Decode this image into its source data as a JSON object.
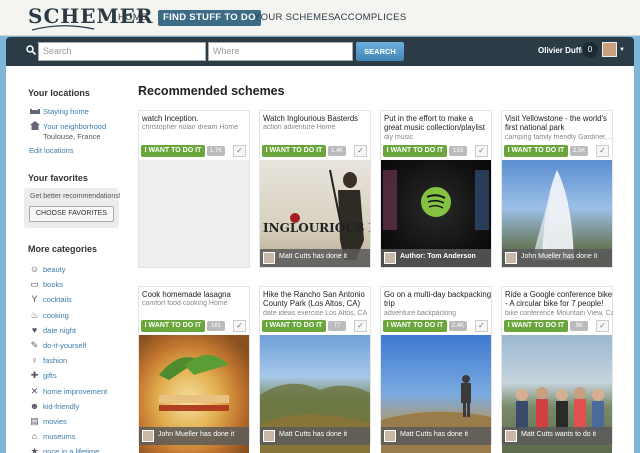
{
  "brand": {
    "logo": "SCHEMER"
  },
  "nav": [
    {
      "label": "HOME"
    },
    {
      "label": "FIND STUFF TO DO"
    },
    {
      "label": "YOUR SCHEMES"
    },
    {
      "label": "ACCOMPLICES"
    }
  ],
  "search": {
    "query_placeholder": "Search",
    "where_placeholder": "Where",
    "button": "SEARCH"
  },
  "user": {
    "name": "Olivier Duffez",
    "count": "0"
  },
  "sidebar": {
    "locations_title": "Your locations",
    "locations": [
      {
        "label": "Staying home",
        "icon": "sofa-icon"
      },
      {
        "label": "Your neighborhood",
        "sub": "Toulouse, France",
        "icon": "house-icon"
      }
    ],
    "edit_locations": "Edit locations",
    "favorites_title": "Your favorites",
    "favorites_hint": "Get better recommendations!",
    "choose_favorites": "CHOOSE FAVORITES",
    "categories_title": "More categories",
    "categories": [
      {
        "label": "beauty",
        "icon": "☺"
      },
      {
        "label": "books",
        "icon": "▭"
      },
      {
        "label": "cocktails",
        "icon": "Y"
      },
      {
        "label": "cooking",
        "icon": "♨"
      },
      {
        "label": "date night",
        "icon": "♥"
      },
      {
        "label": "do-it-yourself",
        "icon": "✎"
      },
      {
        "label": "fashion",
        "icon": "♀"
      },
      {
        "label": "gifts",
        "icon": "✚"
      },
      {
        "label": "home improvement",
        "icon": "✕"
      },
      {
        "label": "kid-friendly",
        "icon": "☻"
      },
      {
        "label": "movies",
        "icon": "▤"
      },
      {
        "label": "museums",
        "icon": "⌂"
      },
      {
        "label": "once in a lifetime",
        "icon": "★"
      }
    ]
  },
  "content": {
    "title": "Recommended schemes",
    "cta": "I WANT TO DO IT",
    "cards": [
      {
        "title": "watch Inception.",
        "tags": "christopher nolan dream Home",
        "count": "1.7K",
        "footer": ""
      },
      {
        "title": "Watch Inglourious Basterds",
        "tags": "action adventure Home",
        "count": "1.4K",
        "footer": "Matt Cutts has done it",
        "poster": "INGLOURIOUS BASTERDS"
      },
      {
        "title": "Put in the effort to make a great music collection/playlist",
        "tags": "diy music",
        "count": "133",
        "footer": "Author: Tom Anderson"
      },
      {
        "title": "Visit Yellowstone - the world's first national park",
        "tags": "camping family friendly Gardiner, ...",
        "count": "2.5K",
        "footer": "John Mueller has done it"
      },
      {
        "title": "Cook homemade lasagna",
        "tags": "comfort food cooking Home",
        "count": "181",
        "footer": "John Mueller has done it"
      },
      {
        "title": "Hike the Rancho San Antonio County Park (Los Altos, CA)",
        "tags": "date ideas exercise Los Altos, CA",
        "count": "77",
        "footer": "Matt Cutts has done it"
      },
      {
        "title": "Go on a multi-day backpacking trip",
        "tags": "adventure backpacking",
        "count": "2.4K",
        "footer": "Matt Cutts has done it"
      },
      {
        "title": "Ride a Google conference bike - A circular bike for 7 people!",
        "tags": "bike conference Mountain View, Ca...",
        "count": "98",
        "footer": "Matt Cutts wants to do it"
      }
    ]
  },
  "colors": {
    "accent": "#3c6c86",
    "cta_green": "#6aa63c",
    "link": "#3c7cae",
    "page_bg": "#7fb6d8"
  }
}
